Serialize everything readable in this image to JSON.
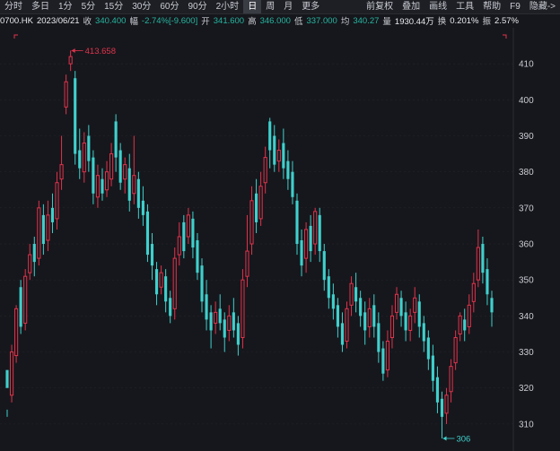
{
  "toolbar": {
    "items": [
      {
        "label": "分时"
      },
      {
        "label": "多日"
      },
      {
        "label": "1分"
      },
      {
        "label": "5分"
      },
      {
        "label": "15分"
      },
      {
        "label": "30分"
      },
      {
        "label": "60分"
      },
      {
        "label": "90分"
      },
      {
        "label": "2小时"
      },
      {
        "label": "日",
        "active": true
      },
      {
        "label": "周"
      },
      {
        "label": "月"
      },
      {
        "label": "更多"
      }
    ],
    "right_items": [
      {
        "label": "前复权"
      },
      {
        "label": "叠加"
      },
      {
        "label": "画线"
      },
      {
        "label": "工具"
      },
      {
        "label": "帮助"
      },
      {
        "label": "F9"
      },
      {
        "label": "隐藏->"
      }
    ]
  },
  "info": {
    "symbol": "0700.HK",
    "date": "2023/06/21",
    "close_label": "收",
    "close": "340.400",
    "change_label": "幅",
    "change": "-2.74%[-9.600]",
    "open_label": "开",
    "open": "341.600",
    "high_label": "高",
    "high": "346.000",
    "low_label": "低",
    "low": "337.000",
    "avg_label": "均",
    "avg": "340.27",
    "volume_label": "量",
    "volume": "1930.44万",
    "turnover_label": "换",
    "turnover": "0.201%",
    "amplitude_label": "振",
    "amplitude": "2.57%"
  },
  "colors": {
    "up": "#e0334c",
    "down": "#3fd0cd",
    "background": "#16171c",
    "grid": "#262830"
  },
  "chart_data": {
    "type": "candlestick",
    "ylim": [
      305,
      418
    ],
    "y_ticks": [
      310,
      320,
      330,
      340,
      350,
      360,
      370,
      380,
      390,
      400,
      410
    ],
    "annotations": [
      {
        "text": "413.658",
        "value": 413.658,
        "kind": "high"
      },
      {
        "text": "306",
        "value": 306,
        "kind": "low"
      }
    ],
    "candles": [
      [
        320,
        325,
        314,
        312,
        "down"
      ],
      [
        318,
        330,
        332,
        316,
        "up"
      ],
      [
        329,
        342,
        343,
        327,
        "up"
      ],
      [
        348,
        337,
        350,
        335,
        "down"
      ],
      [
        338,
        351,
        353,
        336,
        "up"
      ],
      [
        352,
        357,
        360,
        350,
        "up"
      ],
      [
        360,
        355,
        362,
        351,
        "down"
      ],
      [
        356,
        370,
        372,
        354,
        "up"
      ],
      [
        368,
        360,
        371,
        357,
        "down"
      ],
      [
        361,
        368,
        372,
        358,
        "up"
      ],
      [
        370,
        366,
        374,
        363,
        "down"
      ],
      [
        367,
        377,
        380,
        364,
        "up"
      ],
      [
        378,
        382,
        390,
        375,
        "up"
      ],
      [
        398,
        405,
        407,
        396,
        "up"
      ],
      [
        410,
        412,
        413.658,
        408,
        "up"
      ],
      [
        406,
        385,
        408,
        382,
        "down"
      ],
      [
        386,
        381,
        392,
        378,
        "down"
      ],
      [
        380,
        388,
        391,
        377,
        "up"
      ],
      [
        390,
        383,
        393,
        380,
        "down"
      ],
      [
        384,
        374,
        386,
        371,
        "down"
      ],
      [
        373,
        379,
        382,
        370,
        "up"
      ],
      [
        378,
        374,
        381,
        372,
        "down"
      ],
      [
        375,
        380,
        383,
        373,
        "up"
      ],
      [
        378,
        385,
        388,
        376,
        "up"
      ],
      [
        394,
        384,
        396,
        380,
        "down"
      ],
      [
        386,
        377,
        388,
        375,
        "down"
      ],
      [
        378,
        382,
        384,
        374,
        "up"
      ],
      [
        381,
        372,
        385,
        369,
        "down"
      ],
      [
        374,
        379,
        390,
        371,
        "up"
      ],
      [
        378,
        370,
        380,
        367,
        "down"
      ],
      [
        372,
        368,
        376,
        365,
        "down"
      ],
      [
        369,
        357,
        371,
        355,
        "down"
      ],
      [
        360,
        354,
        363,
        350,
        "down"
      ],
      [
        353,
        346,
        355,
        343,
        "down"
      ],
      [
        348,
        352,
        354,
        346,
        "up"
      ],
      [
        351,
        344,
        353,
        341,
        "down"
      ],
      [
        345,
        340,
        347,
        338,
        "down"
      ],
      [
        342,
        356,
        359,
        339,
        "up"
      ],
      [
        357,
        362,
        366,
        354,
        "up"
      ],
      [
        366,
        358,
        368,
        356,
        "down"
      ],
      [
        362,
        368,
        370,
        360,
        "up"
      ],
      [
        367,
        359,
        369,
        356,
        "down"
      ],
      [
        361,
        352,
        363,
        350,
        "down"
      ],
      [
        354,
        344,
        356,
        341,
        "down"
      ],
      [
        346,
        339,
        350,
        336,
        "down"
      ],
      [
        341,
        336,
        343,
        331,
        "down"
      ],
      [
        338,
        341,
        344,
        335,
        "up"
      ],
      [
        342,
        338,
        346,
        336,
        "down"
      ],
      [
        339,
        334,
        341,
        330,
        "down"
      ],
      [
        336,
        340,
        343,
        333,
        "up"
      ],
      [
        341,
        336,
        345,
        334,
        "down"
      ],
      [
        338,
        332,
        340,
        329,
        "down"
      ],
      [
        334,
        350,
        353,
        331,
        "up"
      ],
      [
        351,
        358,
        368,
        348,
        "up"
      ],
      [
        360,
        372,
        376,
        357,
        "up"
      ],
      [
        374,
        366,
        378,
        363,
        "down"
      ],
      [
        367,
        376,
        380,
        365,
        "up"
      ],
      [
        377,
        384,
        387,
        374,
        "up"
      ],
      [
        386,
        394,
        395,
        381,
        "down"
      ],
      [
        390,
        382,
        393,
        380,
        "down"
      ],
      [
        383,
        386,
        389,
        380,
        "up"
      ],
      [
        388,
        381,
        392,
        378,
        "down"
      ],
      [
        383,
        378,
        386,
        375,
        "down"
      ],
      [
        380,
        373,
        383,
        371,
        "down"
      ],
      [
        372,
        360,
        374,
        357,
        "down"
      ],
      [
        361,
        354,
        364,
        351,
        "down"
      ],
      [
        356,
        364,
        366,
        352,
        "up"
      ],
      [
        365,
        358,
        368,
        355,
        "down"
      ],
      [
        360,
        369,
        370,
        357,
        "up"
      ],
      [
        368,
        358,
        370,
        355,
        "down"
      ],
      [
        358,
        350,
        360,
        347,
        "down"
      ],
      [
        351,
        345,
        353,
        342,
        "down"
      ],
      [
        346,
        342,
        349,
        339,
        "down"
      ],
      [
        343,
        337,
        345,
        334,
        "down"
      ],
      [
        338,
        332,
        341,
        330,
        "down"
      ],
      [
        333,
        342,
        344,
        331,
        "up"
      ],
      [
        343,
        349,
        351,
        340,
        "up"
      ],
      [
        348,
        344,
        352,
        341,
        "down"
      ],
      [
        345,
        340,
        347,
        337,
        "down"
      ],
      [
        341,
        336,
        344,
        332,
        "down"
      ],
      [
        337,
        342,
        345,
        334,
        "up"
      ],
      [
        343,
        337,
        346,
        334,
        "down"
      ],
      [
        338,
        330,
        341,
        327,
        "down"
      ],
      [
        331,
        324,
        333,
        322,
        "down"
      ],
      [
        325,
        333,
        336,
        323,
        "up"
      ],
      [
        334,
        340,
        343,
        331,
        "up"
      ],
      [
        341,
        346,
        348,
        339,
        "up"
      ],
      [
        345,
        340,
        347,
        337,
        "down"
      ],
      [
        341,
        336,
        344,
        333,
        "down"
      ],
      [
        336,
        340,
        342,
        333,
        "up"
      ],
      [
        341,
        345,
        348,
        338,
        "up"
      ],
      [
        344,
        337,
        346,
        334,
        "down"
      ],
      [
        338,
        333,
        340,
        330,
        "down"
      ],
      [
        334,
        328,
        336,
        325,
        "down"
      ],
      [
        329,
        322,
        332,
        319,
        "down"
      ],
      [
        323,
        316,
        326,
        313,
        "down"
      ],
      [
        317,
        312,
        319,
        306,
        "down"
      ],
      [
        313,
        318,
        320,
        310,
        "up"
      ],
      [
        319,
        326,
        328,
        316,
        "up"
      ],
      [
        327,
        334,
        336,
        325,
        "up"
      ],
      [
        335,
        340,
        341,
        333,
        "up"
      ],
      [
        339,
        336,
        342,
        333,
        "down"
      ],
      [
        337,
        343,
        346,
        335,
        "up"
      ],
      [
        344,
        349,
        352,
        341,
        "up"
      ],
      [
        350,
        359,
        364,
        348,
        "up"
      ],
      [
        360,
        352,
        362,
        349,
        "down"
      ],
      [
        353,
        346,
        356,
        343,
        "down"
      ],
      [
        345,
        341,
        347,
        337,
        "down"
      ]
    ]
  }
}
